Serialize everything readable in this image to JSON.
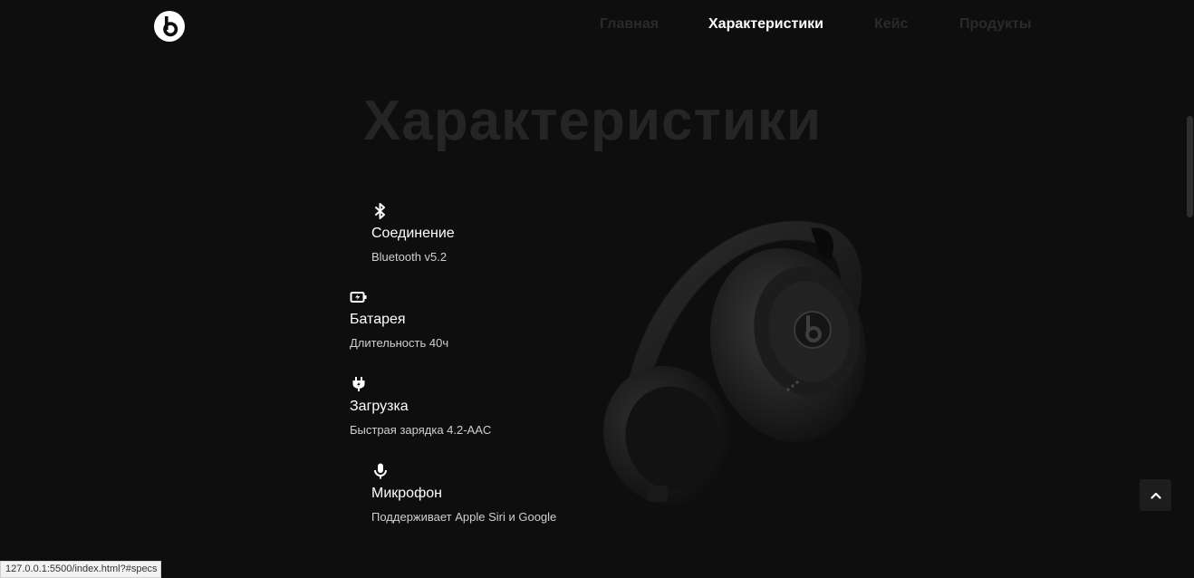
{
  "header": {
    "logo_icon": "beats-logo-icon",
    "nav": [
      {
        "label": "Главная",
        "active": false
      },
      {
        "label": "Характеристики",
        "active": true
      },
      {
        "label": "Кейс",
        "active": false
      },
      {
        "label": "Продукты",
        "active": false
      }
    ]
  },
  "specs": {
    "title": "Характеристики",
    "items": [
      {
        "icon": "bluetooth-icon",
        "name": "Соединение",
        "desc": "Bluetooth v5.2"
      },
      {
        "icon": "battery-charging-icon",
        "name": "Батарея",
        "desc": "Длительность 40ч"
      },
      {
        "icon": "plug-icon",
        "name": "Загрузка",
        "desc": "Быстрая зарядка 4.2-AAC"
      },
      {
        "icon": "microphone-icon",
        "name": "Микрофон",
        "desc": "Поддерживает Apple Siri и Google"
      }
    ]
  },
  "back_to_top_icon": "chevron-up-icon",
  "status_bar": {
    "url": "127.0.0.1:5500/index.html?#specs"
  },
  "colors": {
    "background": "#0e0e0e",
    "nav_active": "#ffffff",
    "nav_dim": "#2a2a2a",
    "title": "#252525"
  }
}
